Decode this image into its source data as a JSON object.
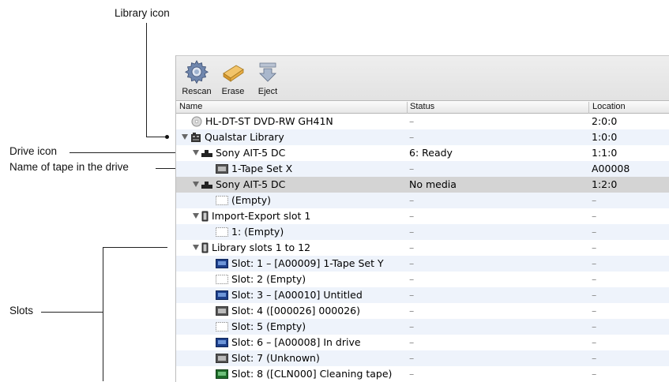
{
  "callouts": {
    "library_icon": "Library icon",
    "drive_icon": "Drive icon",
    "tape_name": "Name of tape in the drive",
    "slots": "Slots"
  },
  "toolbar": {
    "rescan_label": "Rescan",
    "erase_label": "Erase",
    "eject_label": "Eject"
  },
  "columns": {
    "name": "Name",
    "status": "Status",
    "location": "Location"
  },
  "rows": [
    {
      "name": "HL-DT-ST DVD-RW GH41N",
      "status": "–",
      "location": "2:0:0",
      "icon": "disc-icon"
    },
    {
      "name": "Qualstar Library",
      "status": "–",
      "location": "1:0:0",
      "icon": "library-icon"
    },
    {
      "name": "Sony AIT-5 DC",
      "status": "6: Ready",
      "location": "1:1:0",
      "icon": "drive-icon"
    },
    {
      "name": "1-Tape Set X",
      "status": "–",
      "location": "A00008",
      "icon": "tape-icon"
    },
    {
      "name": "Sony AIT-5 DC",
      "status": "No media",
      "location": "1:2:0",
      "icon": "drive-icon"
    },
    {
      "name": "(Empty)",
      "status": "–",
      "location": "–",
      "icon": "empty-slot-icon"
    },
    {
      "name": "Import-Export slot 1",
      "status": "–",
      "location": "–",
      "icon": "slot-group-icon"
    },
    {
      "name": "1: (Empty)",
      "status": "–",
      "location": "–",
      "icon": "empty-slot-icon"
    },
    {
      "name": "Library slots 1 to 12",
      "status": "–",
      "location": "–",
      "icon": "slot-group-icon"
    },
    {
      "name": "Slot: 1 – [A00009] 1-Tape Set Y",
      "status": "–",
      "location": "–",
      "icon": "tape-blue-icon"
    },
    {
      "name": "Slot: 2 (Empty)",
      "status": "–",
      "location": "–",
      "icon": "empty-slot-icon"
    },
    {
      "name": "Slot: 3 – [A00010] Untitled",
      "status": "–",
      "location": "–",
      "icon": "tape-blue-icon"
    },
    {
      "name": "Slot: 4 ([000026] 000026)",
      "status": "–",
      "location": "–",
      "icon": "tape-icon"
    },
    {
      "name": "Slot: 5 (Empty)",
      "status": "–",
      "location": "–",
      "icon": "empty-slot-icon"
    },
    {
      "name": "Slot: 6 – [A00008] In drive",
      "status": "–",
      "location": "–",
      "icon": "tape-blue-icon"
    },
    {
      "name": "Slot: 7 (Unknown)",
      "status": "–",
      "location": "–",
      "icon": "tape-icon"
    },
    {
      "name": "Slot: 8 ([CLN000] Cleaning tape)",
      "status": "–",
      "location": "–",
      "icon": "cleaning-tape-icon"
    }
  ]
}
